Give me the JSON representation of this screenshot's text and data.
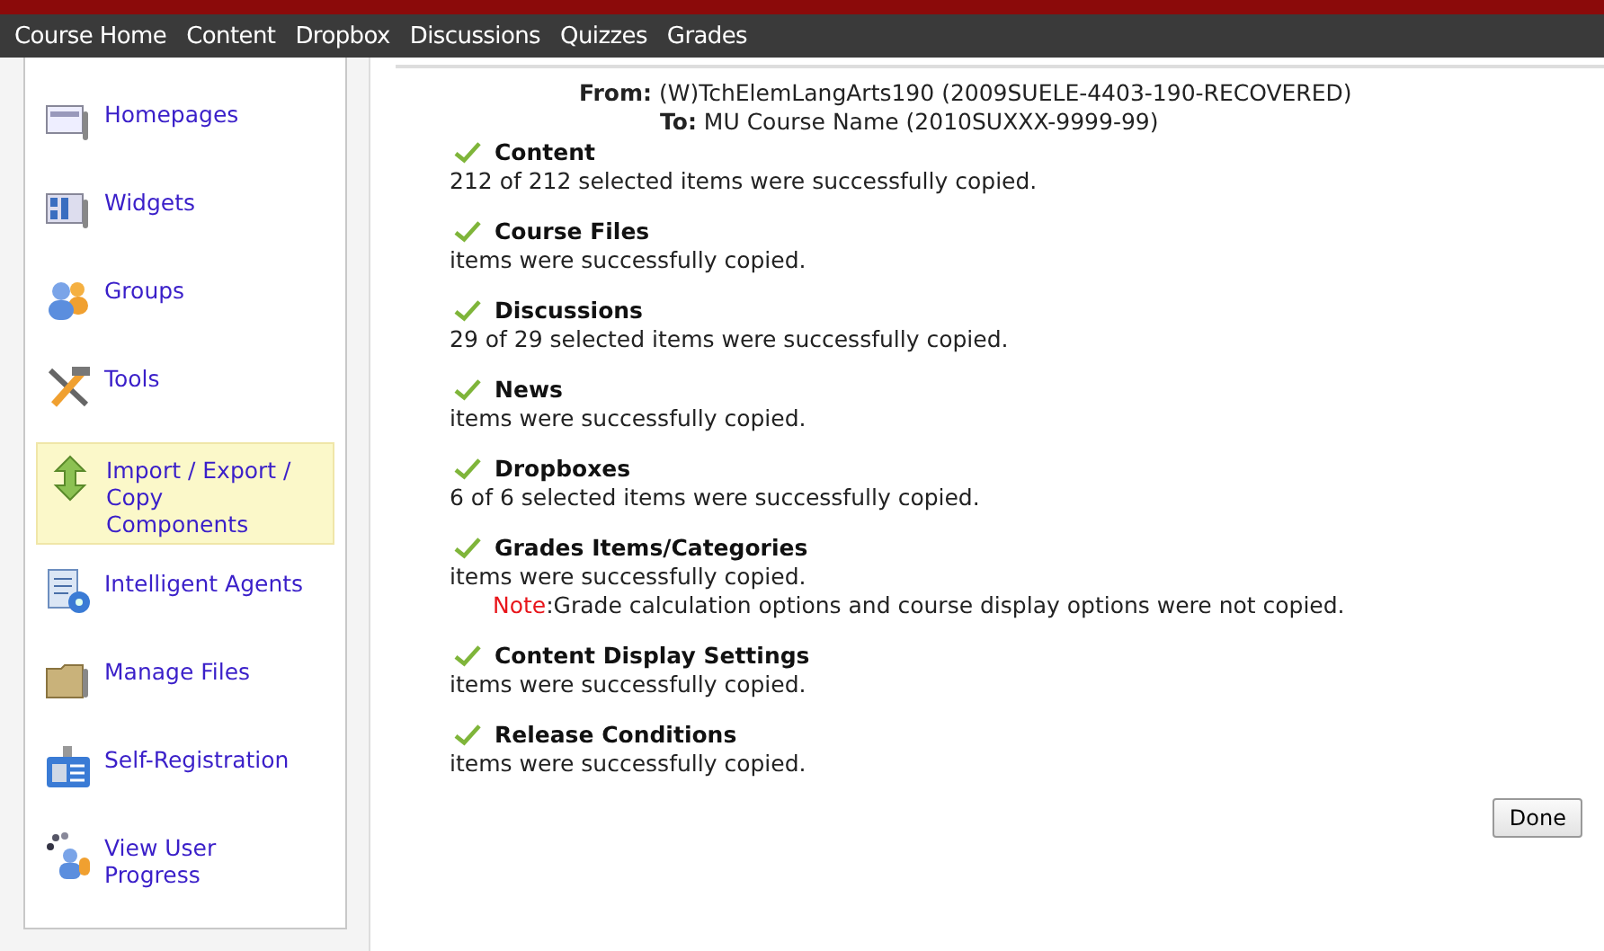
{
  "nav": [
    "Course Home",
    "Content",
    "Dropbox",
    "Discussions",
    "Quizzes",
    "Grades"
  ],
  "sidebar": {
    "items": [
      {
        "label": "Homepages",
        "selected": false
      },
      {
        "label": "Widgets",
        "selected": false
      },
      {
        "label": "Groups",
        "selected": false
      },
      {
        "label": "Tools",
        "selected": false
      },
      {
        "label": "Import / Export / Copy Components",
        "selected": true
      },
      {
        "label": "Intelligent Agents",
        "selected": false
      },
      {
        "label": "Manage Files",
        "selected": false
      },
      {
        "label": "Self-Registration",
        "selected": false
      },
      {
        "label": "View User Progress",
        "selected": false
      }
    ]
  },
  "summary": {
    "from_label": "From:",
    "from": "(W)TchElemLangArts190 (2009SUELE-4403-190-RECOVERED)",
    "to_label": "To:",
    "to": "MU Course Name (2010SUXXX-9999-99)"
  },
  "results": [
    {
      "title": "Content",
      "message": "212 of 212 selected items were successfully copied."
    },
    {
      "title": "Course Files",
      "message": "items were successfully copied."
    },
    {
      "title": "Discussions",
      "message": "29 of 29 selected items were successfully copied."
    },
    {
      "title": "News",
      "message": "items were successfully copied."
    },
    {
      "title": "Dropboxes",
      "message": "6 of 6 selected items were successfully copied."
    },
    {
      "title": "Grades Items/Categories",
      "message": "items were successfully copied.",
      "note": {
        "label": "Note",
        "text": ":Grade calculation options and course display options were not copied."
      }
    },
    {
      "title": "Content Display Settings",
      "message": "items were successfully copied."
    },
    {
      "title": "Release Conditions",
      "message": "items were successfully copied."
    }
  ],
  "done_button": "Done"
}
